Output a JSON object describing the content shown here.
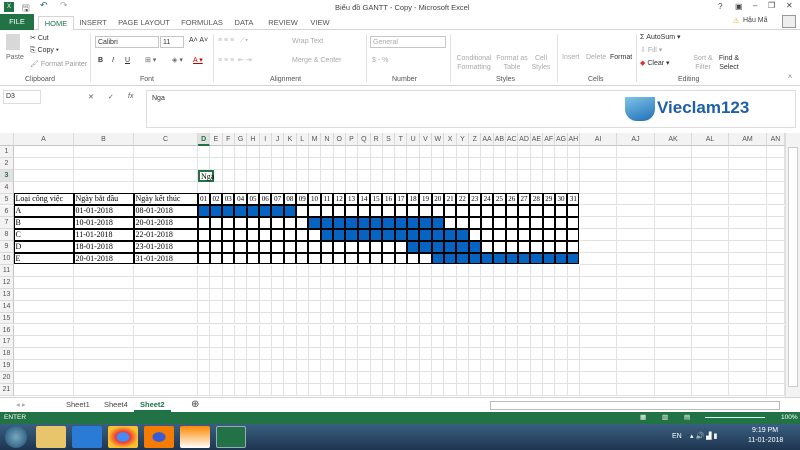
{
  "window": {
    "title": "Biểu đồ GANTT - Copy - Microsoft Excel",
    "user": "Hậu Mã",
    "controls": [
      "?",
      "▣",
      "–",
      "❐",
      "✕"
    ]
  },
  "ribbon_tabs": [
    "FILE",
    "HOME",
    "INSERT",
    "PAGE LAYOUT",
    "FORMULAS",
    "DATA",
    "REVIEW",
    "VIEW"
  ],
  "ribbon": {
    "clipboard": {
      "paste": "Paste",
      "cut": "Cut",
      "copy": "Copy",
      "format_painter": "Format Painter",
      "group": "Clipboard"
    },
    "font": {
      "name": "Calibri",
      "size": "11",
      "group": "Font",
      "bold": "B",
      "italic": "I",
      "underline": "U"
    },
    "alignment": {
      "wrap": "Wrap Text",
      "merge": "Merge & Center",
      "group": "Alignment"
    },
    "number": {
      "format": "General",
      "currency": "$ - %",
      "group": "Number"
    },
    "styles": {
      "conditional": "Conditional Formatting",
      "format_table": "Format as Table",
      "cell_styles": "Cell Styles",
      "group": "Styles"
    },
    "cells": {
      "insert": "Insert",
      "delete": "Delete",
      "format": "Format",
      "group": "Cells"
    },
    "editing": {
      "autosum": "AutoSum",
      "fill": "Fill",
      "clear": "Clear",
      "sort": "Sort & Filter",
      "find": "Find & Select",
      "group": "Editing"
    }
  },
  "formula_bar": {
    "name_box": "D3",
    "value": "Nga",
    "cancel": "✕",
    "enter": "✓",
    "fx": "fx"
  },
  "logo": {
    "text": "Vieclam123"
  },
  "sheet": {
    "columns": [
      "A",
      "B",
      "C",
      "D",
      "E",
      "F",
      "G",
      "H",
      "I",
      "J",
      "K",
      "L",
      "M",
      "N",
      "O",
      "P",
      "Q",
      "R",
      "S",
      "T",
      "U",
      "V",
      "W",
      "X",
      "Y",
      "Z",
      "AA",
      "AB",
      "AC",
      "AD",
      "AE",
      "AF",
      "AG",
      "AH",
      "AI",
      "AJ",
      "AK",
      "AL",
      "AM",
      "AN"
    ],
    "rows": [
      "1",
      "2",
      "3",
      "4",
      "5",
      "6",
      "7",
      "8",
      "9",
      "10",
      "11",
      "12",
      "13",
      "14",
      "15",
      "16",
      "17",
      "18",
      "19",
      "20",
      "21"
    ],
    "selected_cell": "D3",
    "active_cell_text": "Nga",
    "headers": [
      "Loại công việc",
      "Ngày bắt đầu",
      "Ngày kết thúc"
    ],
    "days": [
      "01",
      "02",
      "03",
      "04",
      "05",
      "06",
      "07",
      "08",
      "09",
      "10",
      "11",
      "12",
      "13",
      "14",
      "15",
      "16",
      "17",
      "18",
      "19",
      "20",
      "21",
      "22",
      "23",
      "24",
      "25",
      "26",
      "27",
      "28",
      "29",
      "30",
      "31"
    ],
    "tasks": [
      {
        "name": "A",
        "start": "01-01-2018",
        "end": "08-01-2018",
        "from": 1,
        "to": 8
      },
      {
        "name": "B",
        "start": "10-01-2018",
        "end": "20-01-2018",
        "from": 10,
        "to": 20
      },
      {
        "name": "C",
        "start": "11-01-2018",
        "end": "22-01-2018",
        "from": 11,
        "to": 22
      },
      {
        "name": "D",
        "start": "18-01-2018",
        "end": "23-01-2018",
        "from": 18,
        "to": 23
      },
      {
        "name": "E",
        "start": "20-01-2018",
        "end": "31-01-2018",
        "from": 20,
        "to": 31
      }
    ],
    "bar_color": "#0563c1"
  },
  "sheet_tabs": [
    "Sheet1",
    "Sheet4",
    "Sheet2"
  ],
  "active_sheet": "Sheet2",
  "status": {
    "mode": "ENTER",
    "zoom": "100%"
  },
  "taskbar": {
    "lang": "EN",
    "time": "9:19 PM",
    "date": "11-01-2018"
  },
  "colors": {
    "excel_green": "#217346"
  }
}
